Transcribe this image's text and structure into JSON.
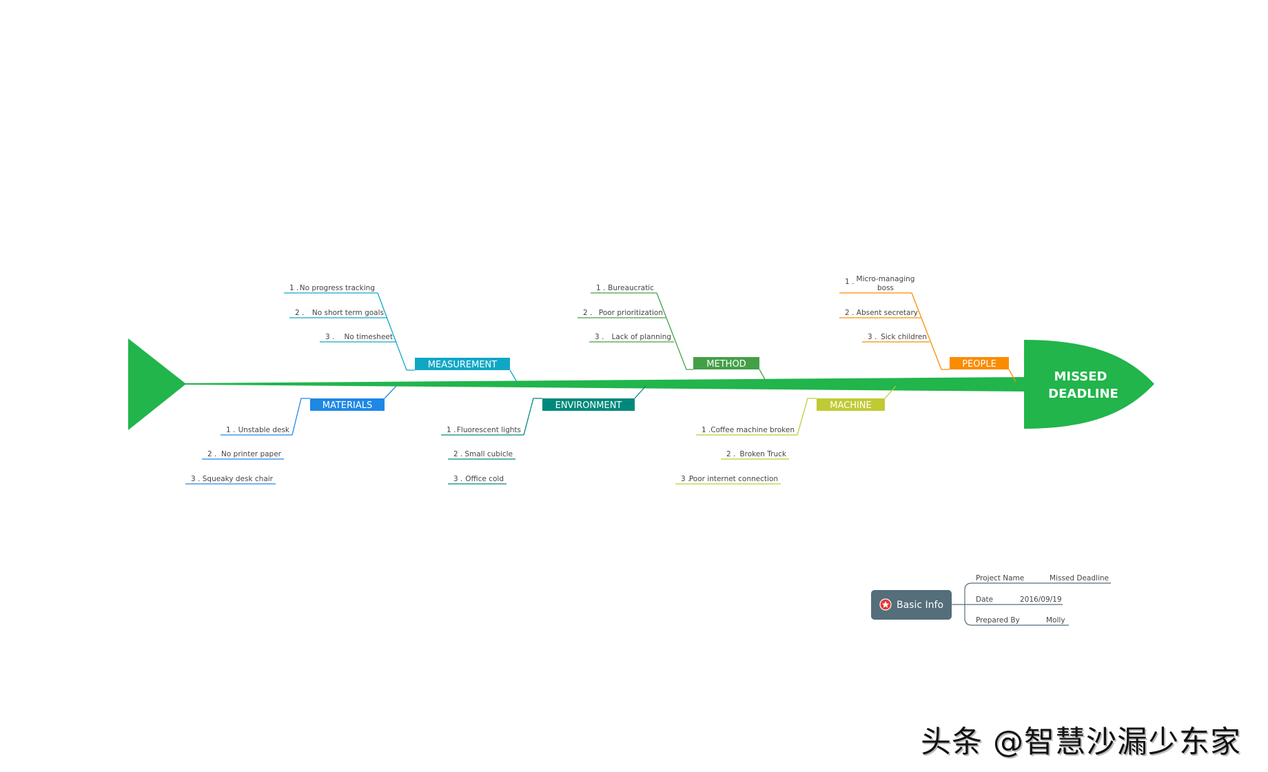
{
  "diagram": {
    "type": "fishbone",
    "head": {
      "line1": "MISSED",
      "line2": "DEADLINE",
      "color": "#21b54b"
    },
    "spine_color": "#21b54b",
    "categories": [
      {
        "id": "measurement",
        "label": "MEASUREMENT",
        "color": "#10a7c5",
        "side": "top",
        "items": [
          {
            "num": "1 .",
            "text": "No progress tracking"
          },
          {
            "num": "2 .",
            "text": "No short term goals"
          },
          {
            "num": "3 .",
            "text": "No timesheet"
          }
        ]
      },
      {
        "id": "method",
        "label": "METHOD",
        "color": "#43a047",
        "side": "top",
        "items": [
          {
            "num": "1 .",
            "text": "Bureaucratic"
          },
          {
            "num": "2 .",
            "text": "Poor prioritization"
          },
          {
            "num": "3 .",
            "text": "Lack of planning"
          }
        ]
      },
      {
        "id": "people",
        "label": "PEOPLE",
        "color": "#fb8c00",
        "side": "top",
        "items": [
          {
            "num": "1 .",
            "text": "Micro-managing",
            "text2": "boss"
          },
          {
            "num": "2 .",
            "text": "Absent secretary"
          },
          {
            "num": "3 .",
            "text": "Sick children"
          }
        ]
      },
      {
        "id": "materials",
        "label": "MATERIALS",
        "color": "#1e88e5",
        "side": "bottom",
        "items": [
          {
            "num": "1 .",
            "text": "Unstable desk"
          },
          {
            "num": "2 .",
            "text": "No printer paper"
          },
          {
            "num": "3 .",
            "text": "Squeaky desk chair"
          }
        ]
      },
      {
        "id": "environment",
        "label": "ENVIRONMENT",
        "color": "#00897b",
        "side": "bottom",
        "items": [
          {
            "num": "1 .",
            "text": "Fluorescent lights"
          },
          {
            "num": "2 .",
            "text": "Small cubicle"
          },
          {
            "num": "3 .",
            "text": "Office cold"
          }
        ]
      },
      {
        "id": "machine",
        "label": "MACHINE",
        "color": "#c0ca33",
        "side": "bottom",
        "items": [
          {
            "num": "1 .",
            "text": "Coffee machine broken"
          },
          {
            "num": "2 .",
            "text": "Broken Truck"
          },
          {
            "num": "3 .",
            "text": "Poor internet connection"
          }
        ]
      }
    ]
  },
  "basic_info": {
    "button_label": "Basic Info",
    "icon": "star-badge-icon",
    "button_color": "#546e7a",
    "icon_color": "#e53935",
    "rows": [
      {
        "label": "Project Name",
        "value": "Missed Deadline"
      },
      {
        "label": "Date",
        "value": "2016/09/19"
      },
      {
        "label": "Prepared By",
        "value": "Molly"
      }
    ]
  },
  "watermark": "头条 @智慧沙漏少东家"
}
